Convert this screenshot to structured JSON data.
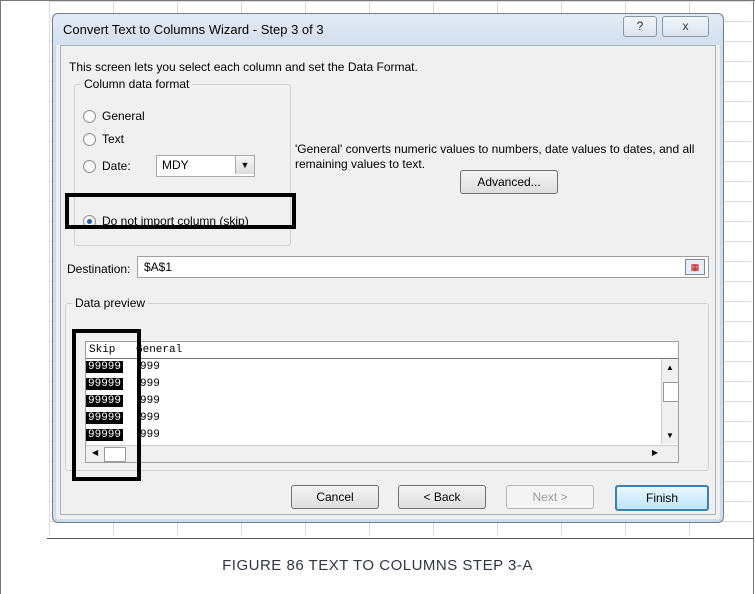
{
  "dialog": {
    "title": "Convert Text to Columns Wizard - Step 3 of 3",
    "help_glyph": "?",
    "close_glyph": "x",
    "description": "This screen lets you select each column and set the Data Format.",
    "column_format": {
      "label": "Column data format",
      "options": [
        {
          "label": "General",
          "underline": "G",
          "checked": false
        },
        {
          "label": "Text",
          "underline": "T",
          "checked": false
        },
        {
          "label": "Date:",
          "underline": "D",
          "checked": false
        },
        {
          "label": "Do not import column (skip)",
          "underline": "i",
          "checked": true
        }
      ],
      "date_value": "MDY",
      "dropdown_glyph": "▼"
    },
    "info_text": "'General' converts numeric values to numbers, date values to dates, and all remaining values to text.",
    "advanced_label": "Advanced...",
    "destination_label": "Destination:",
    "destination_value": "$A$1",
    "preview": {
      "label": "Data preview",
      "headers": [
        "Skip",
        "General"
      ],
      "rows": [
        [
          "99999",
          "999"
        ],
        [
          "99999",
          "999"
        ],
        [
          "99999",
          "999"
        ],
        [
          "99999",
          "999"
        ],
        [
          "99999",
          "999"
        ]
      ]
    },
    "buttons": {
      "cancel": "Cancel",
      "back": "< Back",
      "next": "Next >",
      "finish": "Finish"
    }
  },
  "caption": "Figure 86 Text to Columns Step 3-A",
  "colors": {
    "dialog_bg": "#f0f0f0",
    "title_bar": "#d3dfee",
    "highlight": "#000000"
  }
}
